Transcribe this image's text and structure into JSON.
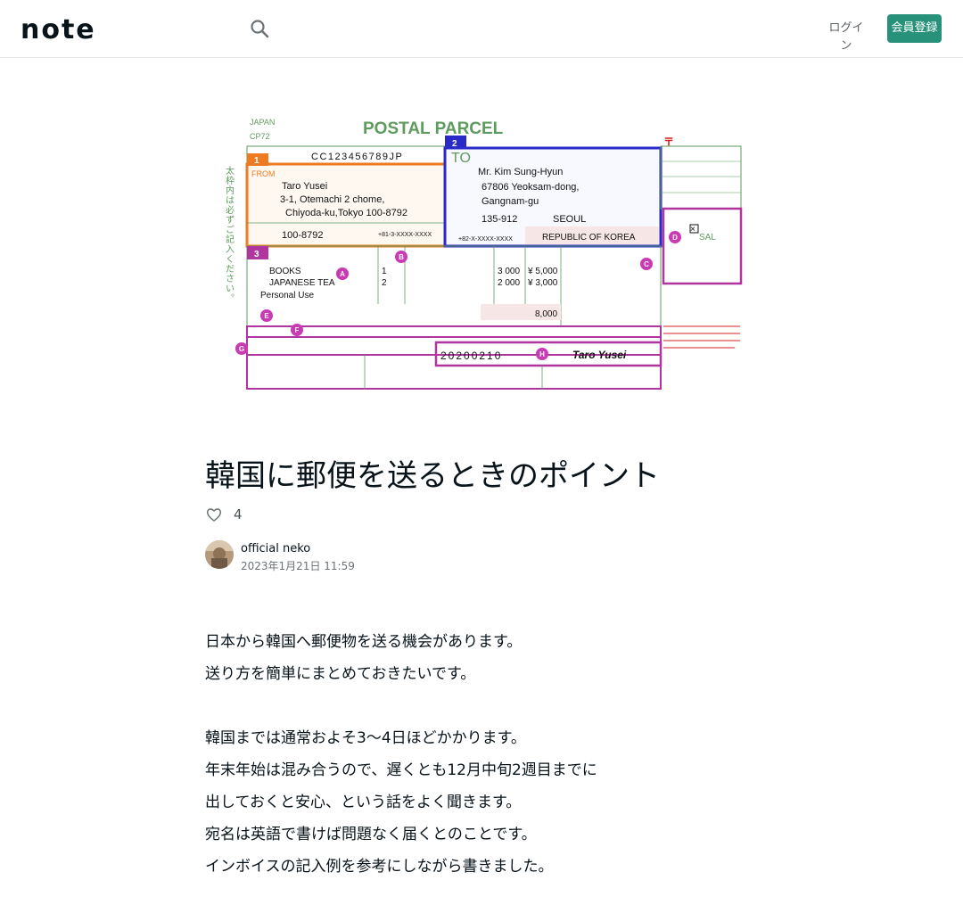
{
  "header": {
    "logo_text": "note",
    "login_label": "ログイン",
    "signup_label": "会員登録"
  },
  "hero": {
    "form_title": "POSTAL PARCEL",
    "header_country": "JAPAN",
    "form_code": "CP72",
    "tracking_number": "CC123456789JP",
    "sender_name": "Taro Yusei",
    "sender_address_1": "3-1, Otemachi 2 chome,",
    "sender_address_2": "Chiyoda-ku,Tokyo 100-8792",
    "sender_postcode": "100-8792",
    "sender_phone": "+81-3-XXXX-XXXX",
    "recipient_name": "Mr. Kim Sung-Hyun",
    "recipient_address_1": "67806 Yeoksam-dong,",
    "recipient_address_2": "Gangnam-gu",
    "recipient_postcode": "135-912",
    "recipient_city": "SEOUL",
    "recipient_phone": "+82-X-XXXX-XXXX",
    "recipient_country": "REPUBLIC OF KOREA",
    "item_1": "BOOKS",
    "item_2": "JAPANESE TEA",
    "item_3": "Personal Use",
    "qty_1": "1",
    "qty_2": "2",
    "weight_1": "3 000",
    "weight_2": "2 000",
    "value_1": "¥ 5,000",
    "value_2": "¥ 3,000",
    "total_value": "8,000",
    "date": "20200210",
    "signature": "Taro Yusei",
    "label_from": "FROM",
    "label_to": "TO",
    "section_1": "1",
    "section_2": "2",
    "section_3": "3",
    "marker_a": "A",
    "marker_b": "B",
    "marker_c": "C",
    "marker_d": "D",
    "marker_e": "E",
    "marker_f": "F",
    "marker_g": "G",
    "marker_h": "H",
    "sal_label": "SAL"
  },
  "article": {
    "title": "韓国に郵便を送るときのポイント",
    "like_count": "4",
    "author_name": "official neko",
    "post_date": "2023年1月21日 11:59",
    "paragraphs": [
      "日本から韓国へ郵便物を送る機会があります。",
      "送り方を簡単にまとめておきたいです。",
      "",
      "韓国までは通常およそ3〜4日ほどかかります。",
      "年末年始は混み合うので、遅くとも12月中旬2週目までに",
      "出しておくと安心、という話をよく聞きます。",
      "宛名は英語で書けば問題なく届くとのことです。",
      "インボイスの記入例を参考にしながら書きました。"
    ]
  },
  "colors": {
    "accent": "#27917a",
    "form_green": "#5e9b5e",
    "form_blue": "#2a2ac8",
    "form_magenta": "#b0359e",
    "form_orange": "#ee7b22"
  }
}
